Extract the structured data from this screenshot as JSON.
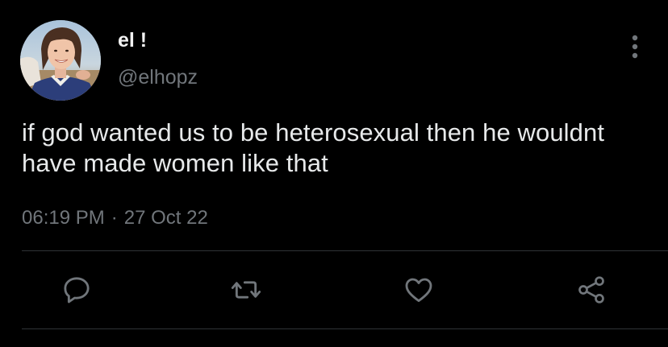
{
  "user": {
    "display_name": "el !",
    "handle": "@elhopz",
    "avatar_icon": "profile-photo"
  },
  "tweet": {
    "text": "if god wanted us to be heterosexual then he wouldnt have made women like that",
    "time": "06:19 PM",
    "separator": "·",
    "date": "27 Oct 22"
  },
  "actions": {
    "reply_icon": "speech-bubble-icon",
    "retweet_icon": "retweet-arrows-icon",
    "like_icon": "heart-icon",
    "share_icon": "share-nodes-icon"
  },
  "colors": {
    "background": "#000000",
    "primary_text": "#e7e9ea",
    "secondary_text": "#71767b",
    "divider": "#2f3336"
  }
}
